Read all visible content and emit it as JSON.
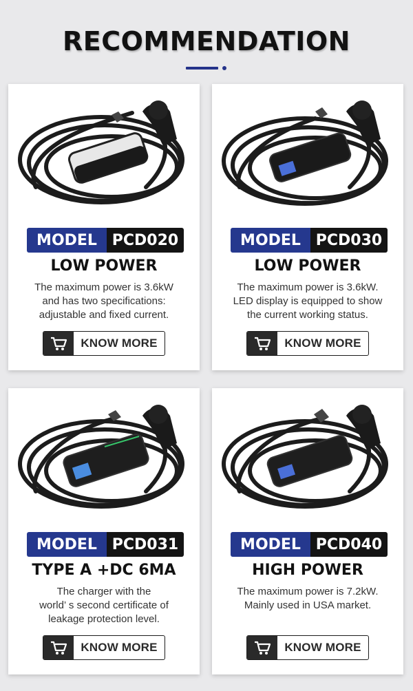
{
  "header": {
    "title": "RECOMMENDATION"
  },
  "colors": {
    "accent_blue": "#25388e",
    "dark": "#141414",
    "background": "#e9e9eb",
    "card": "#ffffff"
  },
  "cards": [
    {
      "model_label": "MODEL",
      "model_number": "PCD020",
      "subtitle": "LOW POWER",
      "description": [
        "The maximum power is 3.6kW",
        "and has two specifications:",
        "adjustable and fixed current."
      ],
      "button": {
        "label": "KNOW MORE",
        "icon": "cart-icon"
      },
      "image": "ev-charger-cable-product-icon"
    },
    {
      "model_label": "MODEL",
      "model_number": "PCD030",
      "subtitle": "LOW POWER",
      "description": [
        "The maximum power is 3.6kW.",
        "LED display is equipped to show",
        "the current working status."
      ],
      "button": {
        "label": "KNOW MORE",
        "icon": "cart-icon"
      },
      "image": "ev-charger-cable-product-icon"
    },
    {
      "model_label": "MODEL",
      "model_number": "PCD031",
      "subtitle": "TYPE A +DC 6MA",
      "description": [
        "The charger with the",
        "world’ s second certificate of",
        "leakage protection level."
      ],
      "button": {
        "label": "KNOW MORE",
        "icon": "cart-icon"
      },
      "image": "ev-charger-cable-product-icon"
    },
    {
      "model_label": "MODEL",
      "model_number": "PCD040",
      "subtitle": "HIGH POWER",
      "description": [
        "The maximum power is 7.2kW.",
        "Mainly used in USA market."
      ],
      "button": {
        "label": "KNOW MORE",
        "icon": "cart-icon"
      },
      "image": "ev-charger-cable-product-icon"
    }
  ]
}
